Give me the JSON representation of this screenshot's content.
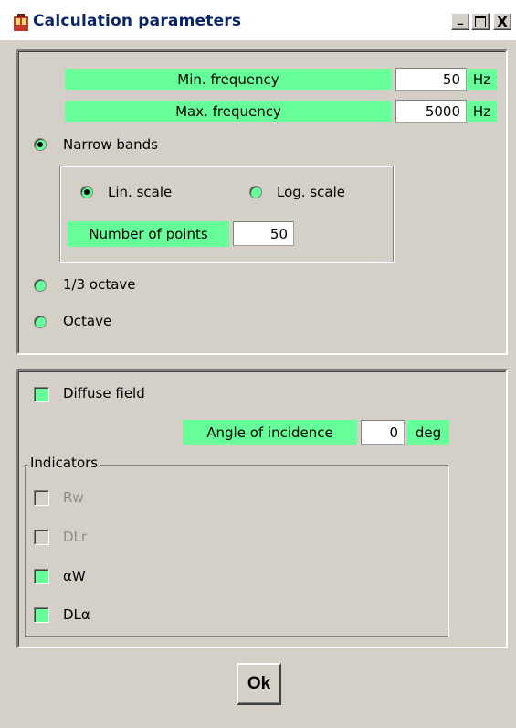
{
  "window": {
    "title": "Calculation parameters",
    "minimize_label": "_",
    "maximize_label": "□",
    "close_label": "X"
  },
  "frequency": {
    "min_label": "Min. frequency",
    "min_value": "50",
    "min_unit": "Hz",
    "max_label": "Max. frequency",
    "max_value": "5000",
    "max_unit": "Hz"
  },
  "band_mode": {
    "narrow_label": "Narrow bands",
    "narrow_selected": true,
    "lin_label": "Lin. scale",
    "lin_selected": true,
    "log_label": "Log. scale",
    "log_selected": false,
    "points_label": "Number of points",
    "points_value": "50",
    "third_octave_label": "1/3 octave",
    "octave_label": "Octave"
  },
  "field": {
    "diffuse_label": "Diffuse field",
    "diffuse_checked": true,
    "angle_label": "Angle of incidence",
    "angle_value": "0",
    "angle_unit": "deg"
  },
  "indicators": {
    "group_label": "Indicators",
    "items": [
      {
        "label": "Rw",
        "checked": false,
        "enabled": false
      },
      {
        "label": "DLr",
        "checked": false,
        "enabled": false
      },
      {
        "label": "αW",
        "checked": true,
        "enabled": true
      },
      {
        "label": "DLα",
        "checked": true,
        "enabled": true
      }
    ]
  },
  "footer": {
    "ok_label": "Ok"
  },
  "colors": {
    "accent_green": "#66ff99",
    "dialog_bg": "#d4d0c8",
    "title_text": "#0a246a"
  }
}
